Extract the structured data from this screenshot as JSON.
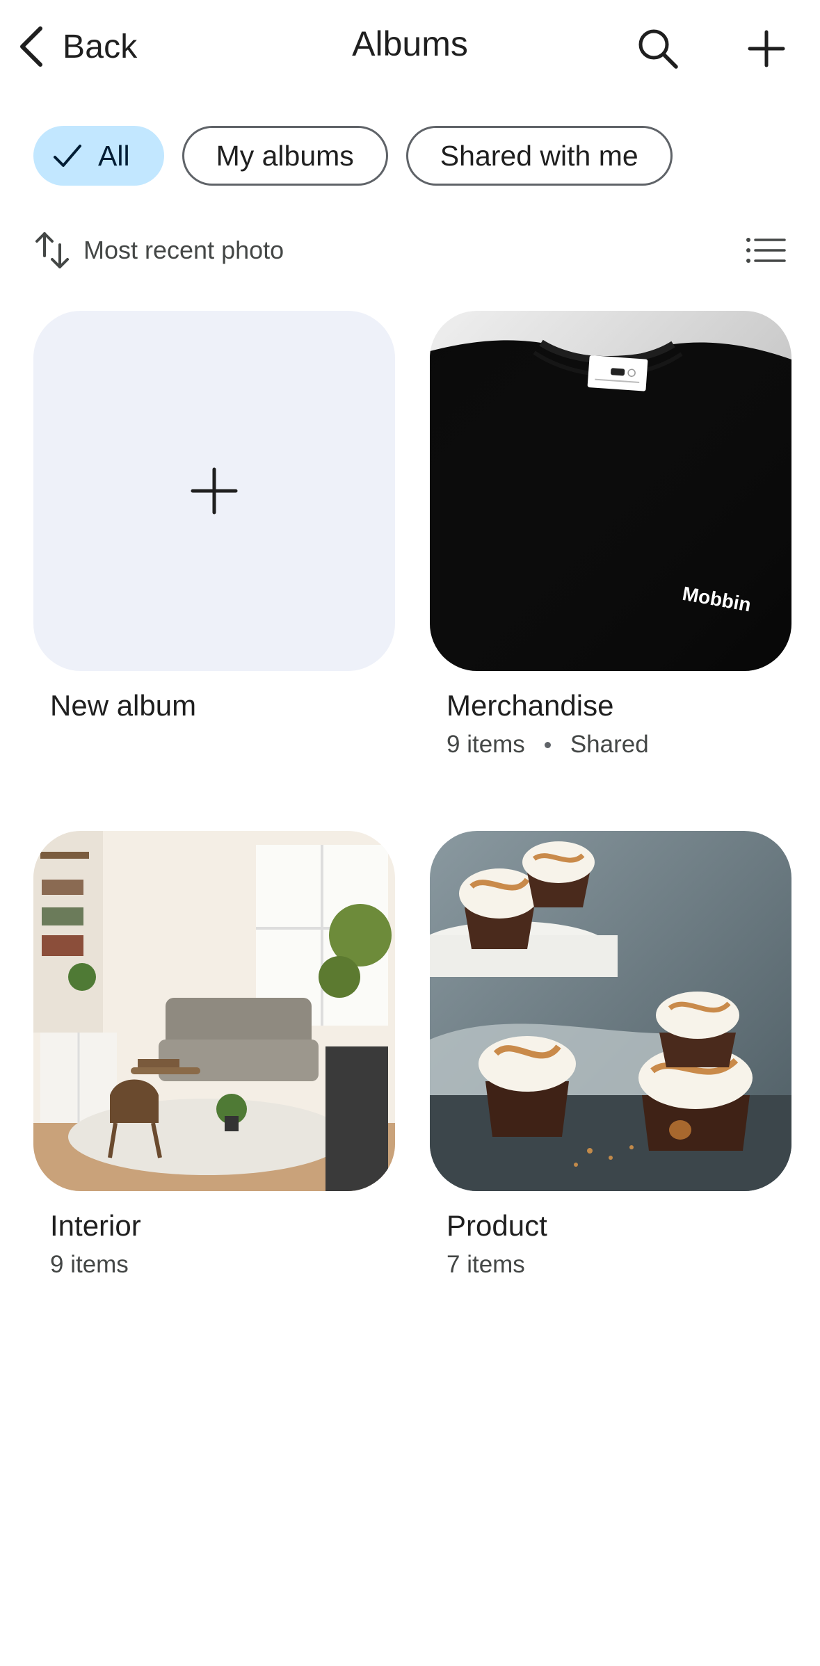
{
  "header": {
    "back_label": "Back",
    "title": "Albums",
    "search_icon": "search-icon",
    "add_icon": "plus-icon"
  },
  "filters": [
    {
      "label": "All",
      "selected": true
    },
    {
      "label": "My albums",
      "selected": false
    },
    {
      "label": "Shared with me",
      "selected": false
    }
  ],
  "sort": {
    "label": "Most recent photo",
    "icon": "sort-arrows-icon",
    "view_icon": "list-view-icon"
  },
  "albums": [
    {
      "title": "New album",
      "type": "create"
    },
    {
      "title": "Merchandise",
      "count": "9 items",
      "shared": "Shared",
      "thumb_brand": "Mobbin"
    },
    {
      "title": "Interior",
      "count": "9 items"
    },
    {
      "title": "Product",
      "count": "7 items"
    }
  ],
  "colors": {
    "accent_chip": "#c2e7ff",
    "new_album_bg": "#eef1f9",
    "text_primary": "#1f1f1f",
    "text_secondary": "#444746"
  }
}
